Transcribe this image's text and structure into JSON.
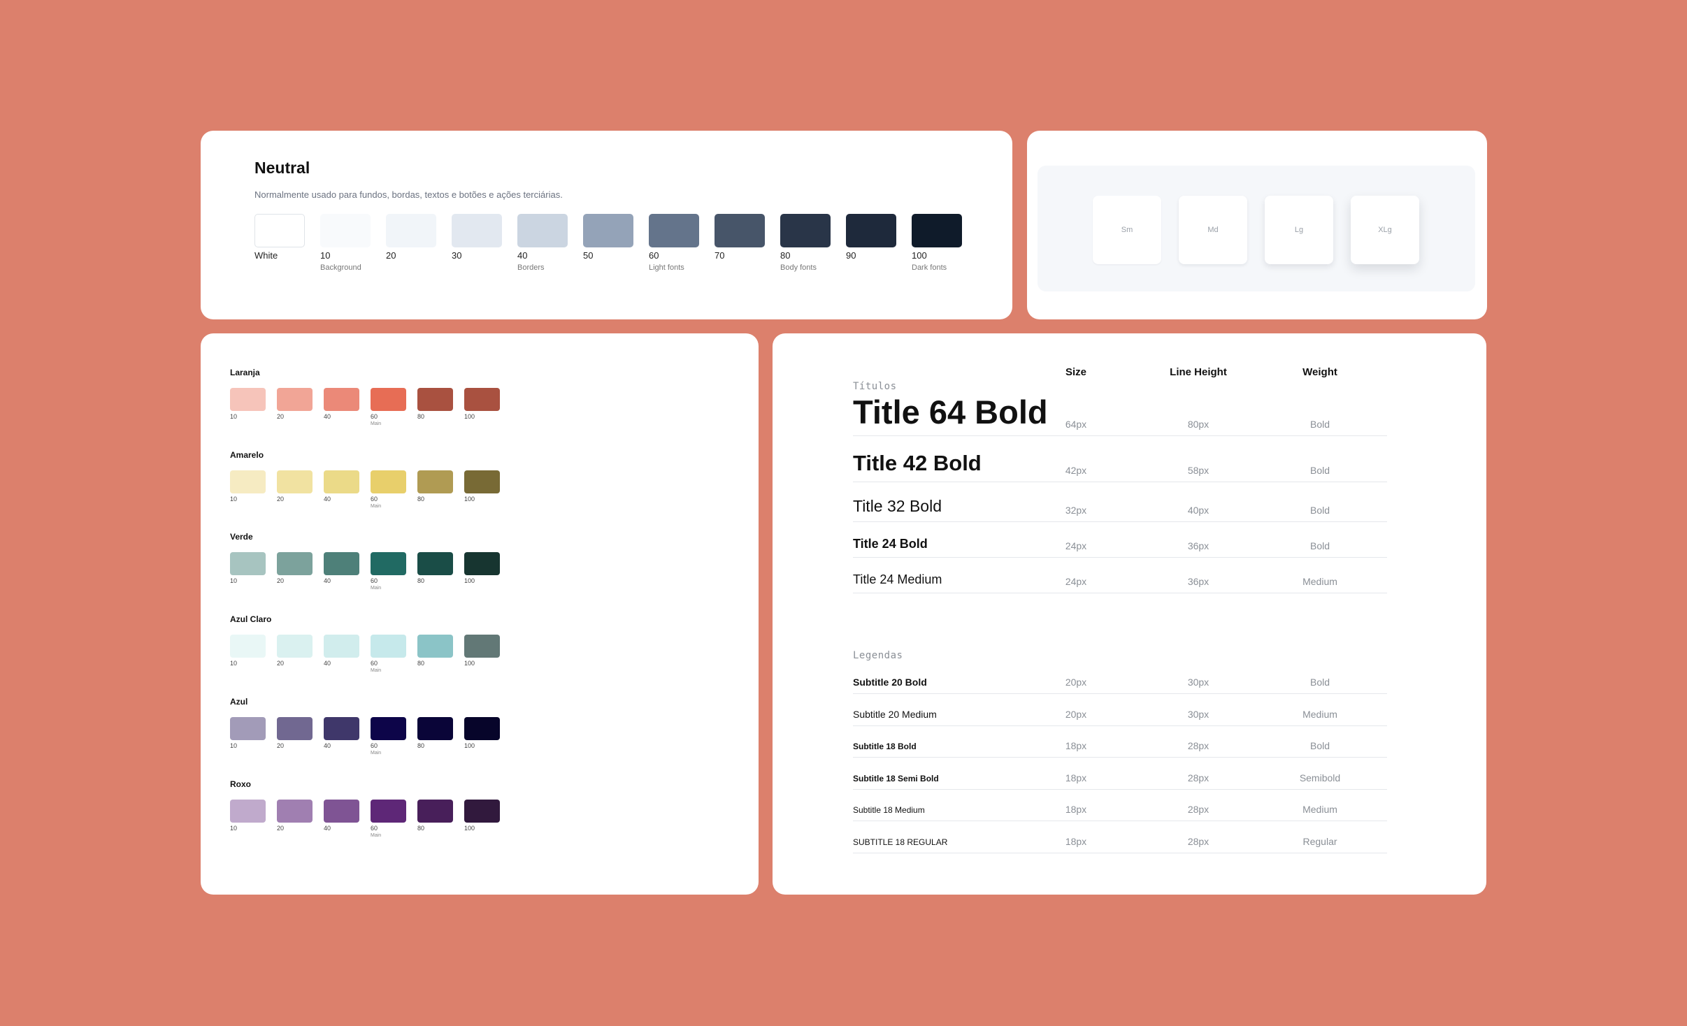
{
  "colors": {
    "background": "#DC806C",
    "card": "#FFFFFF"
  },
  "neutral": {
    "title": "Neutral",
    "description": "Normalmente usado para fundos, bordas, textos e botões e ações terciárias.",
    "swatches": [
      {
        "label": "White",
        "sub": "",
        "color": "#FFFFFF"
      },
      {
        "label": "10",
        "sub": "Background",
        "color": "#F8FAFC"
      },
      {
        "label": "20",
        "sub": "",
        "color": "#F1F5F9"
      },
      {
        "label": "30",
        "sub": "",
        "color": "#E2E8F0"
      },
      {
        "label": "40",
        "sub": "Borders",
        "color": "#CBD5E1"
      },
      {
        "label": "50",
        "sub": "",
        "color": "#94A3B8"
      },
      {
        "label": "60",
        "sub": "Light fonts",
        "color": "#64748B"
      },
      {
        "label": "70",
        "sub": "",
        "color": "#475569"
      },
      {
        "label": "80",
        "sub": "Body fonts",
        "color": "#293548"
      },
      {
        "label": "90",
        "sub": "",
        "color": "#1E293B"
      },
      {
        "label": "100",
        "sub": "Dark fonts",
        "color": "#0F1B2A"
      }
    ]
  },
  "shadows": {
    "boxes": [
      {
        "label": "Sm"
      },
      {
        "label": "Md"
      },
      {
        "label": "Lg"
      },
      {
        "label": "XLg"
      }
    ]
  },
  "palettes": [
    {
      "name": "Laranja",
      "swatches": [
        {
          "label": "10",
          "sub": "",
          "color": "#F6C4BA"
        },
        {
          "label": "20",
          "sub": "",
          "color": "#F1A596"
        },
        {
          "label": "40",
          "sub": "",
          "color": "#EB8978"
        },
        {
          "label": "60",
          "sub": "Main",
          "color": "#E76D55"
        },
        {
          "label": "80",
          "sub": "",
          "color": "#A95140"
        },
        {
          "label": "100",
          "sub": "",
          "color": "#A95140"
        }
      ]
    },
    {
      "name": "Amarelo",
      "swatches": [
        {
          "label": "10",
          "sub": "",
          "color": "#F6EBC2"
        },
        {
          "label": "20",
          "sub": "",
          "color": "#F1E2A1"
        },
        {
          "label": "40",
          "sub": "",
          "color": "#EBDA88"
        },
        {
          "label": "60",
          "sub": "Main",
          "color": "#E8CF6B"
        },
        {
          "label": "80",
          "sub": "",
          "color": "#B09B53"
        },
        {
          "label": "100",
          "sub": "",
          "color": "#786A35"
        }
      ]
    },
    {
      "name": "Verde",
      "swatches": [
        {
          "label": "10",
          "sub": "",
          "color": "#A7C4C0"
        },
        {
          "label": "20",
          "sub": "",
          "color": "#7CA29C"
        },
        {
          "label": "40",
          "sub": "",
          "color": "#4E8079"
        },
        {
          "label": "60",
          "sub": "Main",
          "color": "#216A63"
        },
        {
          "label": "80",
          "sub": "",
          "color": "#1A4D47"
        },
        {
          "label": "100",
          "sub": "",
          "color": "#173530"
        }
      ]
    },
    {
      "name": "Azul Claro",
      "swatches": [
        {
          "label": "10",
          "sub": "",
          "color": "#E9F7F6"
        },
        {
          "label": "20",
          "sub": "",
          "color": "#DAF1F0"
        },
        {
          "label": "40",
          "sub": "",
          "color": "#D1EDED"
        },
        {
          "label": "60",
          "sub": "Main",
          "color": "#C6E9EB"
        },
        {
          "label": "80",
          "sub": "",
          "color": "#8BC4C7"
        },
        {
          "label": "100",
          "sub": "",
          "color": "#627876"
        }
      ]
    },
    {
      "name": "Azul",
      "swatches": [
        {
          "label": "10",
          "sub": "",
          "color": "#A29BB8"
        },
        {
          "label": "20",
          "sub": "",
          "color": "#716891"
        },
        {
          "label": "40",
          "sub": "",
          "color": "#3F376A"
        },
        {
          "label": "60",
          "sub": "Main",
          "color": "#0D0549"
        },
        {
          "label": "80",
          "sub": "",
          "color": "#0A0538"
        },
        {
          "label": "100",
          "sub": "",
          "color": "#07052A"
        }
      ]
    },
    {
      "name": "Roxo",
      "swatches": [
        {
          "label": "10",
          "sub": "",
          "color": "#C0AACC"
        },
        {
          "label": "20",
          "sub": "",
          "color": "#A07FB1"
        },
        {
          "label": "40",
          "sub": "",
          "color": "#7F5494"
        },
        {
          "label": "60",
          "sub": "Main",
          "color": "#5E2777"
        },
        {
          "label": "80",
          "sub": "",
          "color": "#481F5A"
        },
        {
          "label": "100",
          "sub": "",
          "color": "#31193D"
        }
      ]
    }
  ],
  "typography": {
    "headers": {
      "size": "Size",
      "line_height": "Line Height",
      "weight": "Weight"
    },
    "titles_label": "Títulos",
    "titles": [
      {
        "name": "Title 64 Bold",
        "size": "64px",
        "line_height": "80px",
        "weight": "Bold"
      },
      {
        "name": "Title 42 Bold",
        "size": "42px",
        "line_height": "58px",
        "weight": "Bold"
      },
      {
        "name": "Title 32 Bold",
        "size": "32px",
        "line_height": "40px",
        "weight": "Bold"
      },
      {
        "name": "Title 24 Bold",
        "size": "24px",
        "line_height": "36px",
        "weight": "Bold"
      },
      {
        "name": "Title 24 Medium",
        "size": "24px",
        "line_height": "36px",
        "weight": "Medium"
      }
    ],
    "legends_label": "Legendas",
    "legends": [
      {
        "name": "Subtitle 20 Bold",
        "size": "20px",
        "line_height": "30px",
        "weight": "Bold"
      },
      {
        "name": "Subtitle 20 Medium",
        "size": "20px",
        "line_height": "30px",
        "weight": "Medium"
      },
      {
        "name": "Subtitle 18 Bold",
        "size": "18px",
        "line_height": "28px",
        "weight": "Bold"
      },
      {
        "name": "Subtitle 18 Semi Bold",
        "size": "18px",
        "line_height": "28px",
        "weight": "Semibold"
      },
      {
        "name": "Subtitle 18 Medium",
        "size": "18px",
        "line_height": "28px",
        "weight": "Medium"
      },
      {
        "name": "SUBTITLE 18 REGULAR",
        "size": "18px",
        "line_height": "28px",
        "weight": "Regular"
      }
    ]
  }
}
